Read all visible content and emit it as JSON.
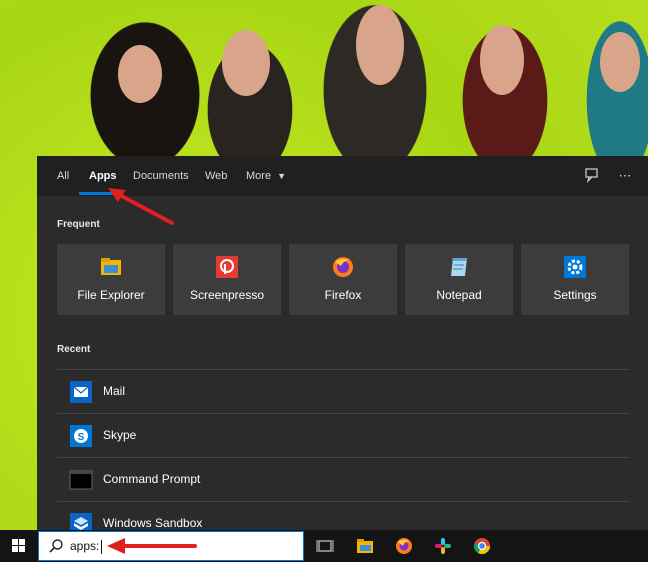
{
  "tabs": {
    "all": "All",
    "apps": "Apps",
    "documents": "Documents",
    "web": "Web",
    "more": "More"
  },
  "sections": {
    "frequent": "Frequent",
    "recent": "Recent"
  },
  "frequent": [
    {
      "label": "File Explorer",
      "icon": "file-explorer-icon"
    },
    {
      "label": "Screenpresso",
      "icon": "screenpresso-icon"
    },
    {
      "label": "Firefox",
      "icon": "firefox-icon"
    },
    {
      "label": "Notepad",
      "icon": "notepad-icon"
    },
    {
      "label": "Settings",
      "icon": "settings-icon"
    }
  ],
  "recent": [
    {
      "label": "Mail",
      "icon": "mail-icon"
    },
    {
      "label": "Skype",
      "icon": "skype-icon"
    },
    {
      "label": "Command Prompt",
      "icon": "command-prompt-icon"
    },
    {
      "label": "Windows Sandbox",
      "icon": "windows-sandbox-icon"
    }
  ],
  "search": {
    "query": "apps:"
  },
  "colors": {
    "accent": "#0078d7",
    "annotation_arrow": "#e0201f",
    "panel_bg": "#2b2b2b",
    "tabbar_bg": "#202020",
    "wallpaper_green": "#b8e01a"
  }
}
